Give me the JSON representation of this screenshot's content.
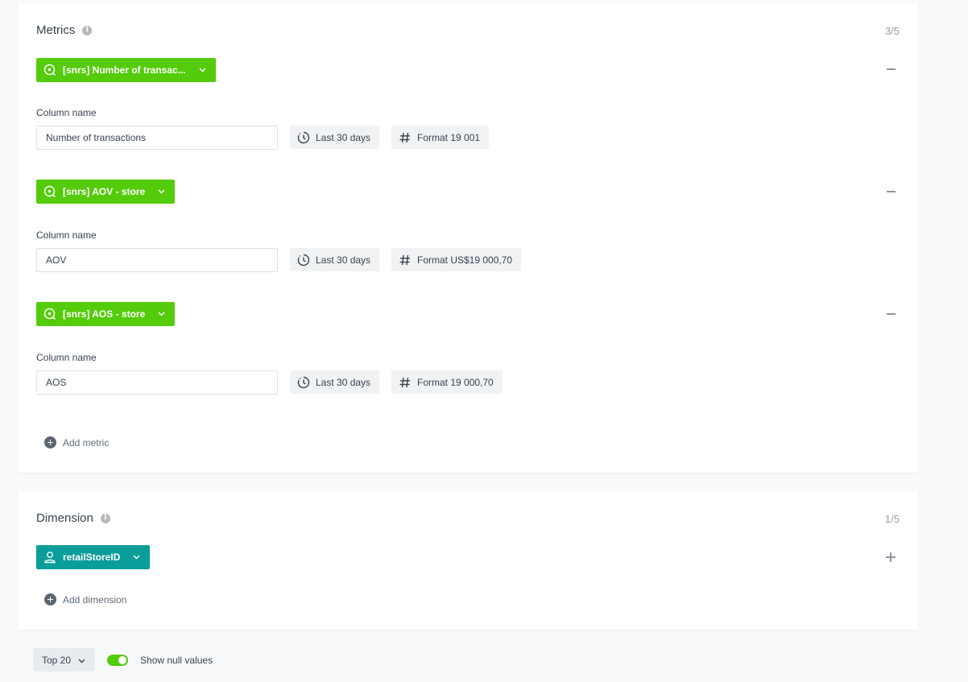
{
  "metrics": {
    "title": "Metrics",
    "counter": "3/5",
    "items": [
      {
        "metric_label": "[snrs] Number of transac...",
        "column_label": "Column name",
        "column_value": "Number of transactions",
        "period": "Last 30 days",
        "format": "Format 19 001"
      },
      {
        "metric_label": "[snrs] AOV - store",
        "column_label": "Column name",
        "column_value": "AOV",
        "period": "Last 30 days",
        "format": "Format US$19 000,70"
      },
      {
        "metric_label": "[snrs] AOS - store",
        "column_label": "Column name",
        "column_value": "AOS",
        "period": "Last 30 days",
        "format": "Format 19 000,70"
      }
    ],
    "add_label": "Add metric"
  },
  "dimension": {
    "title": "Dimension",
    "counter": "1/5",
    "item_label": "retailStoreID",
    "add_label": "Add dimension"
  },
  "footer": {
    "top_select": "Top 20",
    "toggle_label": "Show null values",
    "toggle_on": true
  },
  "colors": {
    "metric_green": "#54cb0b",
    "dimension_teal": "#0b9d99"
  }
}
